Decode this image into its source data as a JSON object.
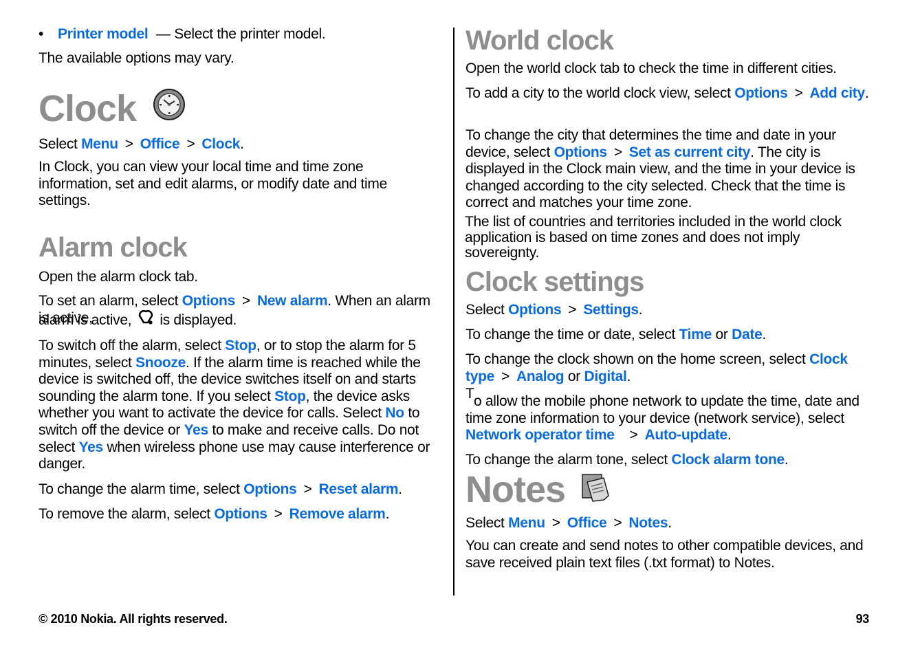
{
  "left": {
    "bullet": {
      "link": "Printer model",
      "text": " — Select the printer model."
    },
    "options_vary": "The available options may vary.",
    "clock": {
      "title": "Clock",
      "icon": "clock-icon",
      "select_prefix": "Select ",
      "path": [
        "Menu",
        "Office",
        "Clock"
      ],
      "intro": "In Clock, you can view your local time and time zone information, set and edit alarms, or modify date and time settings."
    },
    "alarm": {
      "title": "Alarm clock",
      "p1": "Open the alarm clock tab.",
      "p2_prefix": "To set an alarm, select ",
      "p2_link1": "Options",
      "p2_link2": "New alarm",
      "p2_mid": ". When an alarm is active, ",
      "p2_icon": "alarm-bell-icon",
      "p2_suffix": " is displayed.",
      "p3": [
        {
          "t": "To switch off the alarm, select "
        },
        {
          "l": "Stop"
        },
        {
          "t": ", or to stop the alarm for 5 minutes, select "
        },
        {
          "l": "Snooze"
        },
        {
          "t": ". If the alarm time is reached while the device is switched off, the device switches itself on and starts sounding the alarm tone. If you select "
        },
        {
          "l": "Stop"
        },
        {
          "t": ", the device asks whether you want to activate the device for calls. Select "
        },
        {
          "l": "No"
        },
        {
          "t": " to switch off the device or "
        },
        {
          "l": "Yes"
        },
        {
          "t": " to make and receive calls. Do not select "
        },
        {
          "l": "Yes"
        },
        {
          "t": " when wireless phone use may cause interference or danger."
        }
      ],
      "p4_prefix": "To change the alarm time, select ",
      "p4_links": [
        "Options",
        "Reset alarm"
      ],
      "p5_prefix": "To remove the alarm, select ",
      "p5_links": [
        "Options",
        "Remove alarm"
      ]
    }
  },
  "right": {
    "world": {
      "title": "World clock",
      "p1": "Open the world clock tab to check the time in different cities.",
      "p2_prefix": "To add a city to the world clock view, select ",
      "p2_links": [
        "Options",
        "Add city"
      ],
      "p3_prefix": "To change the city that determines the time and date in your device, select ",
      "p3_links": [
        "Options",
        "Set as current city"
      ],
      "p3_suffix": ". The city is displayed in the Clock main view, and the time in your device is changed according to the city selected. Check that the time is correct and matches your time zone.",
      "p4": "The list of countries and territories included in the world clock application is based on time zones and does not imply sovereignty."
    },
    "settings": {
      "title": "Clock settings",
      "p1_prefix": "Select ",
      "p1_links": [
        "Options",
        "Settings"
      ],
      "p2_prefix": "To change the time or date, select ",
      "p2_link1": "Time",
      "p2_or": " or ",
      "p2_link2": "Date",
      "p3_prefix": "To change the clock shown on the home screen, select ",
      "p3_links": [
        "Clock type",
        "Analog",
        "Digital"
      ],
      "p4_cap": "T",
      "p4_prefix": "o allow the mobile phone network to update the time, date and time zone information to your device (network service), select ",
      "p4_links": [
        "Network operator time",
        "Auto-update"
      ],
      "p5_prefix": "To change the alarm tone, select ",
      "p5_link": "Clock alarm tone"
    },
    "notes": {
      "title": "Notes",
      "icon": "notes-icon",
      "select_prefix": "Select ",
      "path": [
        "Menu",
        "Office",
        "Notes"
      ],
      "p1": "You can create and send notes to other compatible devices, and save received plain text files (.txt format) to Notes."
    }
  },
  "footer": {
    "copyright": "© 2010 Nokia. All rights reserved.",
    "page_number": "93"
  },
  "colors": {
    "link": "#0a6be0",
    "heading": "#8e8e8e"
  },
  "separator": ">",
  "period": ".",
  "or": " or "
}
